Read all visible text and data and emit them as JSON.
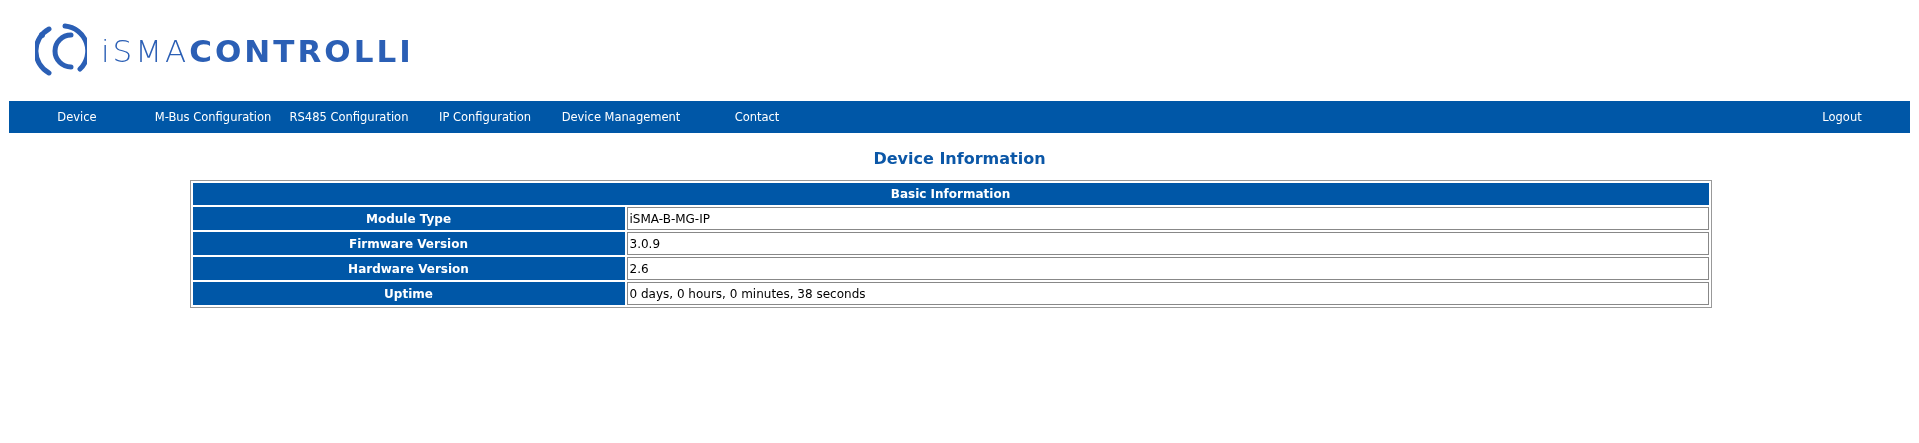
{
  "logo": {
    "wordmark": "iSMA**CONTROLLI**"
  },
  "nav": {
    "items": [
      {
        "label": "Device"
      },
      {
        "label": "M-Bus Configuration"
      },
      {
        "label": "RS485 Configuration"
      },
      {
        "label": "IP Configuration"
      },
      {
        "label": "Device Management"
      },
      {
        "label": "Contact"
      }
    ],
    "logout": "Logout"
  },
  "page_title": "Device Information",
  "table": {
    "header": "Basic Information",
    "rows": [
      {
        "label": "Module Type",
        "value": "iSMA-B-MG-IP"
      },
      {
        "label": "Firmware Version",
        "value": "3.0.9"
      },
      {
        "label": "Hardware Version",
        "value": "2.6"
      },
      {
        "label": "Uptime",
        "value": "0 days, 0 hours, 0 minutes, 38 seconds"
      }
    ]
  }
}
